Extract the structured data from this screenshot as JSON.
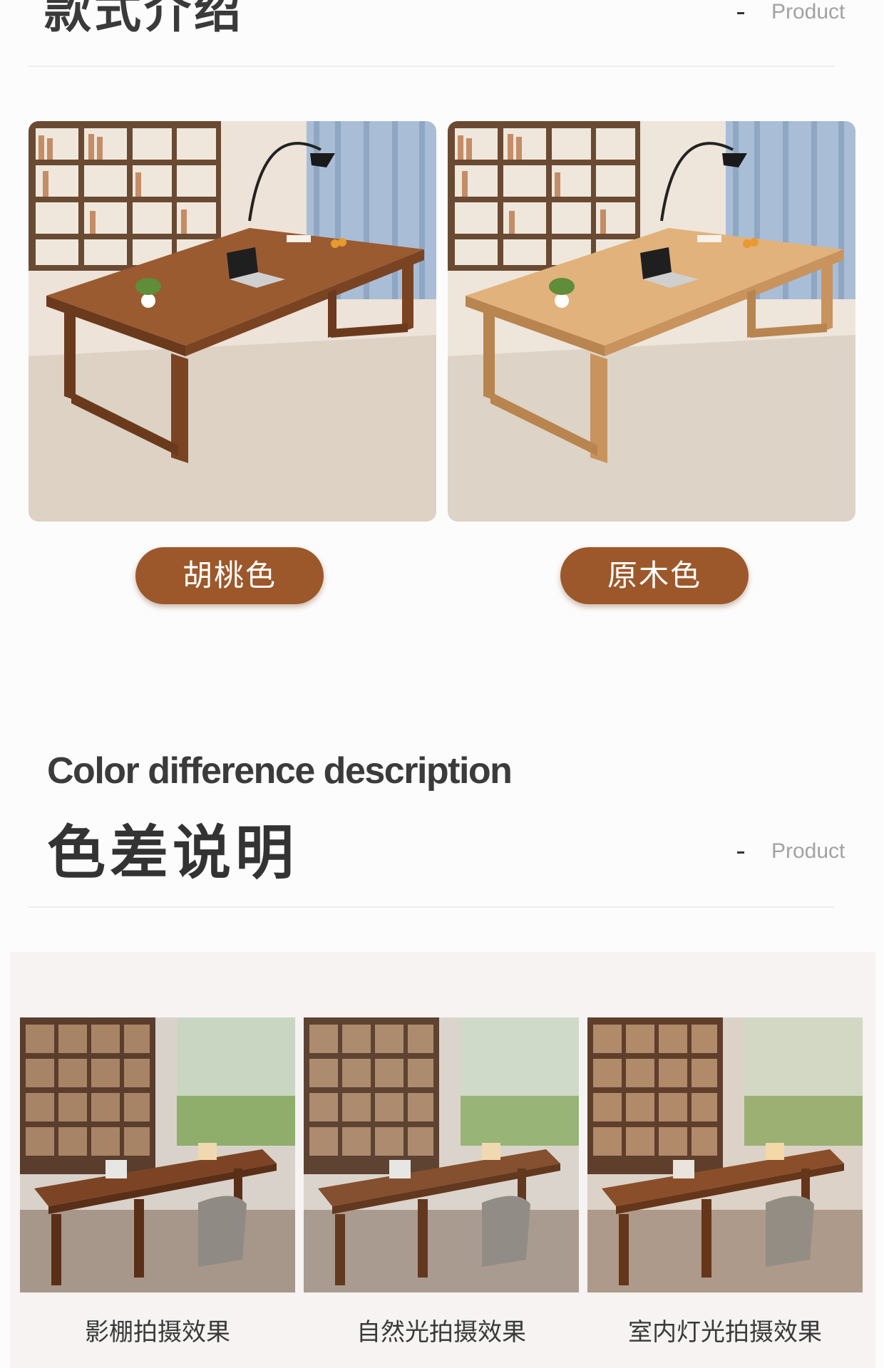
{
  "section_style": {
    "title": "款式介绍",
    "product_tag": "Product",
    "variants": [
      {
        "label": "胡桃色",
        "wood_color": "#7a4322",
        "wood_highlight": "#9a5b31"
      },
      {
        "label": "原木色",
        "wood_color": "#c9935e",
        "wood_highlight": "#e2b27c"
      }
    ]
  },
  "section_color": {
    "title_en": "Color difference description",
    "title_cn": "色差说明",
    "product_tag": "Product",
    "shots": [
      {
        "caption": "影棚拍摄效果",
        "tint": "#ffffff"
      },
      {
        "caption": "自然光拍摄效果",
        "tint": "#f1ebe6"
      },
      {
        "caption": "室内灯光拍摄效果",
        "tint": "#f6e9dc"
      }
    ]
  },
  "colors": {
    "accent": "#9c582b"
  }
}
